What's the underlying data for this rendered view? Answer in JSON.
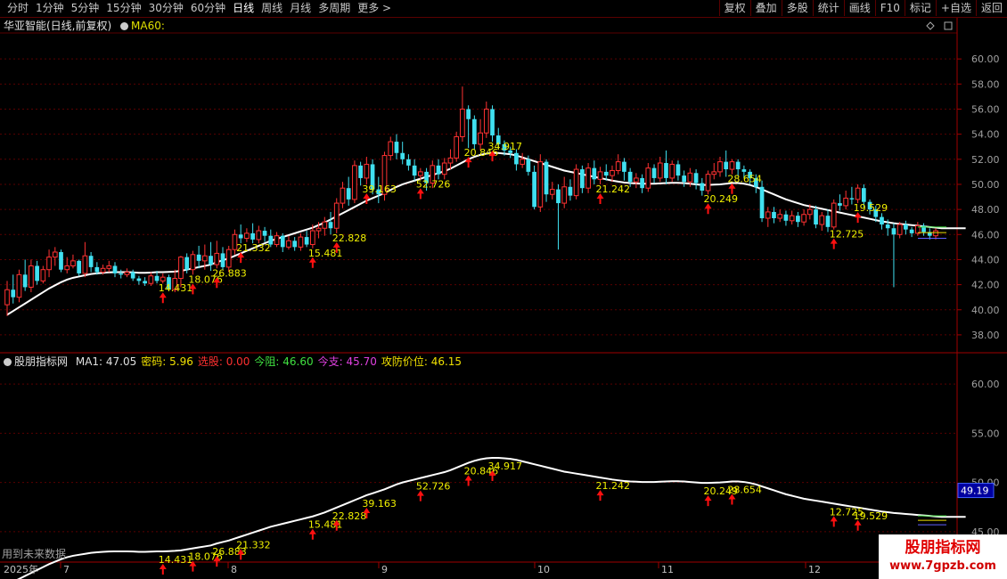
{
  "toolbar": {
    "periods": [
      "分时",
      "1分钟",
      "5分钟",
      "15分钟",
      "30分钟",
      "60分钟",
      "日线",
      "周线",
      "月线",
      "多周期",
      "更多 >"
    ],
    "active_period": "日线",
    "actions": [
      "复权",
      "叠加",
      "多股",
      "统计",
      "画线",
      "F10",
      "标记",
      "+自选",
      "返回"
    ]
  },
  "main_panel": {
    "title": "华亚智能(日线,前复权)",
    "ma_label": "MA60:"
  },
  "indicator_panel": {
    "name": "股朋指标网",
    "items": [
      {
        "label": "MA1:",
        "value": "47.05",
        "color": "#e0e0e0"
      },
      {
        "label": "密码:",
        "value": "5.96",
        "color": "#f0e000"
      },
      {
        "label": "选股:",
        "value": "0.00",
        "color": "#ff3030"
      },
      {
        "label": "今阻:",
        "value": "46.60",
        "color": "#40e040"
      },
      {
        "label": "今支:",
        "value": "45.70",
        "color": "#e040e0"
      },
      {
        "label": "攻防价位:",
        "value": "46.15",
        "color": "#f0e000"
      }
    ],
    "footer_note": "用到未来数据",
    "current_value_box": "49.19"
  },
  "watermark": {
    "line1": "股朋指标网",
    "line2": "www.7gpzb.com"
  },
  "colors": {
    "up": "#ff3232",
    "down": "#40e0f0",
    "ma": "#ffffff",
    "signal": "#ff1010",
    "label": "#f0f000",
    "grid": "#5a0000"
  },
  "chart_data": [
    {
      "type": "candlestick",
      "title": "华亚智能(日线,前复权)",
      "ylim": [
        37,
        62
      ],
      "y_ticks": [
        38,
        40,
        42,
        44,
        46,
        48,
        50,
        52,
        54,
        56,
        58,
        60
      ],
      "x_tick_labels": [
        "2025年",
        "7",
        "8",
        "9",
        "10",
        "11",
        "12"
      ],
      "candles": [
        [
          40.4,
          41.6,
          39.5,
          42.3
        ],
        [
          41.6,
          41.0,
          40.5,
          42.8
        ],
        [
          41.0,
          42.8,
          40.6,
          43.2
        ],
        [
          42.8,
          41.8,
          41.5,
          44.0
        ],
        [
          41.8,
          43.5,
          41.4,
          44.0
        ],
        [
          43.5,
          42.3,
          42.0,
          43.9
        ],
        [
          42.3,
          43.2,
          42.1,
          43.5
        ],
        [
          43.2,
          44.2,
          42.6,
          44.8
        ],
        [
          44.2,
          44.6,
          43.5,
          45.0
        ],
        [
          44.6,
          43.2,
          43.0,
          44.8
        ],
        [
          43.2,
          43.5,
          42.9,
          44.2
        ],
        [
          43.5,
          43.9,
          43.3,
          44.4
        ],
        [
          43.9,
          42.9,
          42.7,
          44.0
        ],
        [
          42.9,
          44.3,
          42.6,
          45.4
        ],
        [
          44.3,
          43.4,
          43.0,
          44.6
        ],
        [
          43.4,
          43.0,
          42.8,
          43.8
        ],
        [
          43.0,
          43.3,
          42.8,
          43.6
        ],
        [
          43.3,
          43.5,
          43.0,
          43.9
        ],
        [
          43.5,
          42.9,
          42.6,
          43.8
        ],
        [
          42.9,
          42.8,
          42.5,
          43.2
        ],
        [
          42.8,
          43.0,
          42.6,
          43.3
        ],
        [
          43.0,
          42.5,
          42.3,
          43.2
        ],
        [
          42.5,
          42.3,
          42.0,
          42.7
        ],
        [
          42.3,
          42.1,
          41.9,
          42.6
        ],
        [
          42.1,
          42.7,
          41.9,
          43.0
        ],
        [
          42.7,
          42.3,
          42.1,
          43.1
        ],
        [
          42.3,
          42.6,
          42.1,
          42.9
        ],
        [
          42.6,
          41.6,
          41.5,
          42.8
        ],
        [
          41.6,
          42.5,
          41.4,
          43.2
        ],
        [
          42.5,
          44.2,
          41.8,
          44.3
        ],
        [
          44.2,
          43.2,
          42.9,
          44.5
        ],
        [
          43.2,
          44.4,
          42.8,
          44.7
        ],
        [
          44.4,
          43.9,
          43.3,
          45.1
        ],
        [
          43.9,
          44.3,
          43.2,
          45.2
        ],
        [
          44.3,
          43.6,
          43.1,
          45.4
        ],
        [
          43.6,
          44.5,
          43.3,
          45.5
        ],
        [
          44.5,
          43.4,
          43.2,
          45.0
        ],
        [
          43.4,
          44.8,
          43.0,
          45.1
        ],
        [
          44.8,
          46.0,
          44.4,
          46.4
        ],
        [
          46.0,
          45.7,
          45.3,
          46.8
        ],
        [
          45.7,
          46.1,
          45.4,
          46.5
        ],
        [
          46.1,
          45.6,
          45.3,
          46.9
        ],
        [
          45.6,
          46.3,
          45.3,
          46.7
        ],
        [
          46.3,
          45.9,
          45.4,
          46.6
        ],
        [
          45.9,
          45.2,
          45.0,
          46.4
        ],
        [
          45.2,
          45.9,
          45.0,
          46.2
        ],
        [
          45.9,
          45.0,
          44.6,
          46.1
        ],
        [
          45.0,
          45.5,
          44.8,
          45.9
        ],
        [
          45.5,
          45.0,
          44.7,
          45.8
        ],
        [
          45.0,
          45.8,
          44.7,
          46.1
        ],
        [
          45.8,
          45.2,
          45.0,
          46.3
        ],
        [
          45.2,
          46.3,
          44.9,
          46.8
        ],
        [
          46.3,
          46.5,
          45.7,
          47.0
        ],
        [
          46.5,
          47.0,
          45.9,
          47.4
        ],
        [
          47.0,
          46.5,
          46.0,
          47.8
        ],
        [
          46.5,
          48.5,
          46.1,
          48.9
        ],
        [
          48.5,
          49.7,
          48.1,
          50.2
        ],
        [
          49.7,
          48.8,
          48.3,
          50.6
        ],
        [
          48.8,
          51.5,
          48.5,
          51.9
        ],
        [
          51.5,
          50.5,
          49.9,
          51.8
        ],
        [
          50.5,
          51.6,
          50.0,
          52.2
        ],
        [
          51.6,
          49.6,
          49.2,
          52.0
        ],
        [
          49.6,
          49.2,
          48.5,
          50.6
        ],
        [
          49.2,
          52.3,
          48.7,
          52.6
        ],
        [
          52.3,
          53.4,
          51.9,
          53.8
        ],
        [
          53.4,
          52.5,
          52.0,
          54.0
        ],
        [
          52.5,
          52.0,
          51.6,
          53.4
        ],
        [
          52.0,
          51.5,
          51.1,
          52.4
        ],
        [
          51.5,
          50.7,
          50.3,
          52.0
        ],
        [
          50.7,
          51.0,
          50.4,
          51.3
        ],
        [
          51.0,
          50.1,
          49.5,
          51.3
        ],
        [
          50.1,
          51.5,
          49.7,
          51.9
        ],
        [
          51.5,
          50.8,
          50.4,
          52.0
        ],
        [
          50.8,
          51.7,
          50.4,
          52.1
        ],
        [
          51.7,
          52.1,
          51.2,
          52.8
        ],
        [
          52.1,
          53.8,
          51.8,
          54.2
        ],
        [
          53.8,
          56.0,
          53.4,
          57.8
        ],
        [
          56.0,
          55.2,
          52.9,
          56.3
        ],
        [
          55.2,
          53.2,
          52.8,
          55.5
        ],
        [
          53.2,
          54.1,
          52.7,
          55.2
        ],
        [
          54.1,
          56.0,
          53.7,
          56.6
        ],
        [
          56.0,
          53.9,
          53.4,
          56.3
        ],
        [
          53.9,
          53.2,
          52.8,
          54.5
        ],
        [
          53.2,
          52.7,
          52.3,
          53.5
        ],
        [
          52.7,
          52.5,
          52.1,
          53.0
        ],
        [
          52.5,
          51.6,
          51.1,
          52.8
        ],
        [
          51.6,
          52.0,
          51.3,
          52.5
        ],
        [
          52.0,
          51.0,
          50.7,
          52.3
        ],
        [
          51.0,
          48.2,
          48.0,
          51.5
        ],
        [
          48.2,
          51.8,
          47.8,
          52.4
        ],
        [
          51.8,
          49.2,
          48.6,
          52.0
        ],
        [
          49.2,
          49.6,
          48.8,
          50.2
        ],
        [
          49.6,
          48.5,
          44.8,
          50.0
        ],
        [
          48.5,
          49.8,
          48.1,
          50.6
        ],
        [
          49.8,
          49.1,
          48.7,
          50.4
        ],
        [
          49.1,
          51.2,
          48.8,
          51.6
        ],
        [
          51.2,
          49.7,
          49.3,
          51.5
        ],
        [
          49.7,
          51.3,
          49.3,
          51.7
        ],
        [
          51.3,
          50.4,
          50.0,
          51.9
        ],
        [
          50.4,
          51.0,
          50.0,
          51.4
        ],
        [
          51.0,
          50.7,
          50.3,
          51.6
        ],
        [
          50.7,
          51.1,
          50.2,
          51.5
        ],
        [
          51.1,
          51.8,
          50.8,
          52.4
        ],
        [
          51.8,
          51.0,
          50.3,
          52.1
        ],
        [
          51.0,
          50.2,
          49.8,
          51.3
        ],
        [
          50.2,
          50.5,
          49.7,
          50.9
        ],
        [
          50.5,
          49.7,
          49.3,
          50.8
        ],
        [
          49.7,
          51.3,
          49.4,
          51.7
        ],
        [
          51.3,
          50.5,
          50.1,
          51.6
        ],
        [
          50.5,
          51.7,
          50.2,
          52.2
        ],
        [
          51.7,
          50.5,
          50.0,
          52.7
        ],
        [
          50.5,
          51.6,
          50.2,
          51.9
        ],
        [
          51.6,
          50.7,
          50.3,
          51.9
        ],
        [
          50.7,
          50.2,
          49.8,
          51.1
        ],
        [
          50.2,
          50.9,
          49.8,
          51.3
        ],
        [
          50.9,
          50.1,
          49.6,
          51.2
        ],
        [
          50.1,
          49.5,
          49.1,
          50.5
        ],
        [
          49.5,
          50.8,
          49.2,
          51.1
        ],
        [
          50.8,
          51.0,
          50.4,
          51.7
        ],
        [
          51.0,
          51.8,
          50.6,
          52.2
        ],
        [
          51.8,
          51.2,
          50.6,
          52.7
        ],
        [
          51.2,
          51.8,
          50.8,
          52.0
        ],
        [
          51.8,
          51.2,
          50.7,
          52.0
        ],
        [
          51.2,
          51.0,
          50.5,
          51.5
        ],
        [
          51.0,
          50.5,
          50.0,
          51.2
        ],
        [
          50.5,
          49.8,
          49.3,
          50.8
        ],
        [
          49.8,
          47.3,
          47.0,
          50.3
        ],
        [
          47.3,
          47.8,
          46.6,
          48.2
        ],
        [
          47.8,
          47.3,
          46.9,
          48.2
        ],
        [
          47.3,
          47.6,
          47.0,
          48.0
        ],
        [
          47.6,
          47.1,
          46.7,
          47.9
        ],
        [
          47.1,
          47.5,
          46.8,
          47.9
        ],
        [
          47.5,
          47.0,
          46.6,
          47.8
        ],
        [
          47.0,
          47.6,
          46.7,
          48.0
        ],
        [
          47.6,
          48.0,
          47.2,
          48.4
        ],
        [
          48.0,
          46.8,
          46.5,
          48.3
        ],
        [
          46.8,
          47.5,
          46.3,
          47.8
        ],
        [
          47.5,
          46.6,
          46.2,
          48.0
        ],
        [
          46.6,
          48.5,
          46.4,
          48.8
        ],
        [
          48.5,
          48.3,
          47.9,
          49.2
        ],
        [
          48.3,
          48.9,
          48.0,
          49.5
        ],
        [
          48.9,
          48.8,
          48.4,
          49.8
        ],
        [
          48.8,
          49.7,
          48.5,
          50.0
        ],
        [
          49.7,
          48.6,
          48.2,
          50.0
        ],
        [
          48.6,
          48.0,
          47.6,
          48.8
        ],
        [
          48.0,
          47.4,
          47.0,
          48.3
        ],
        [
          47.4,
          46.8,
          46.4,
          47.7
        ],
        [
          46.8,
          46.5,
          45.9,
          47.2
        ],
        [
          46.5,
          46.0,
          41.8,
          46.9
        ],
        [
          46.0,
          46.8,
          45.7,
          47.0
        ],
        [
          46.8,
          46.4,
          46.0,
          47.1
        ],
        [
          46.4,
          46.1,
          45.8,
          46.6
        ],
        [
          46.1,
          46.7,
          45.9,
          47.0
        ],
        [
          46.7,
          46.2,
          45.9,
          46.9
        ],
        [
          46.2,
          45.9,
          45.6,
          46.5
        ],
        [
          45.9,
          46.3,
          45.6,
          46.5
        ]
      ],
      "ma60": [
        39.6,
        39.9,
        40.2,
        40.5,
        40.8,
        41.1,
        41.4,
        41.7,
        41.95,
        42.2,
        42.4,
        42.55,
        42.65,
        42.75,
        42.85,
        42.9,
        42.95,
        42.98,
        43.0,
        43.0,
        43.0,
        42.98,
        42.95,
        42.95,
        42.97,
        43.0,
        43.0,
        43.02,
        43.05,
        43.1,
        43.2,
        43.3,
        43.4,
        43.5,
        43.6,
        43.8,
        43.95,
        44.1,
        44.3,
        44.5,
        44.7,
        44.9,
        45.1,
        45.3,
        45.5,
        45.65,
        45.8,
        45.95,
        46.1,
        46.25,
        46.4,
        46.55,
        46.75,
        46.95,
        47.2,
        47.45,
        47.7,
        47.95,
        48.2,
        48.45,
        48.7,
        48.9,
        49.1,
        49.3,
        49.55,
        49.8,
        50.0,
        50.15,
        50.3,
        50.45,
        50.6,
        50.75,
        50.9,
        51.05,
        51.25,
        51.5,
        51.75,
        52.0,
        52.2,
        52.35,
        52.45,
        52.5,
        52.5,
        52.45,
        52.4,
        52.3,
        52.15,
        52.0,
        51.85,
        51.7,
        51.55,
        51.4,
        51.25,
        51.1,
        51.0,
        50.9,
        50.8,
        50.7,
        50.6,
        50.5,
        50.4,
        50.3,
        50.22,
        50.15,
        50.1,
        50.08,
        50.05,
        50.05,
        50.05,
        50.08,
        50.1,
        50.12,
        50.12,
        50.1,
        50.05,
        50.0,
        49.95,
        49.95,
        49.98,
        50.0,
        50.05,
        50.1,
        50.1,
        50.05,
        49.95,
        49.8,
        49.6,
        49.4,
        49.2,
        49.0,
        48.8,
        48.65,
        48.5,
        48.35,
        48.25,
        48.15,
        48.05,
        47.95,
        47.85,
        47.75,
        47.65,
        47.55,
        47.45,
        47.35,
        47.25,
        47.15,
        47.05,
        46.98,
        46.9,
        46.85,
        46.8,
        46.75,
        46.7,
        46.65,
        46.6,
        46.55,
        46.5,
        46.5,
        46.5,
        46.5,
        46.5
      ],
      "level_lines": {
        "resistance": 46.6,
        "support": 45.7,
        "attack_defense": 46.15
      },
      "signals": [
        {
          "index": 26,
          "label": "14.431"
        },
        {
          "index": 31,
          "label": "18.076"
        },
        {
          "index": 35,
          "label": "26.883"
        },
        {
          "index": 39,
          "label": "21.332"
        },
        {
          "index": 51,
          "label": "15.481"
        },
        {
          "index": 55,
          "label": "22.828"
        },
        {
          "index": 60,
          "label": "39.163"
        },
        {
          "index": 69,
          "label": "52.726"
        },
        {
          "index": 77,
          "label": "20.846"
        },
        {
          "index": 81,
          "label": "34.917"
        },
        {
          "index": 99,
          "label": "21.242"
        },
        {
          "index": 117,
          "label": "20.249"
        },
        {
          "index": 121,
          "label": "28.654"
        },
        {
          "index": 138,
          "label": "12.725"
        },
        {
          "index": 142,
          "label": "19.529"
        }
      ]
    },
    {
      "type": "line",
      "title": "股朋指标网",
      "ylim": [
        42.0,
        63.0
      ],
      "y_ticks": [
        45.0,
        50.0,
        55.0,
        60.0
      ],
      "series": [
        {
          "name": "MA1",
          "color": "#ffffff"
        }
      ],
      "latest_value": 49.19
    }
  ]
}
